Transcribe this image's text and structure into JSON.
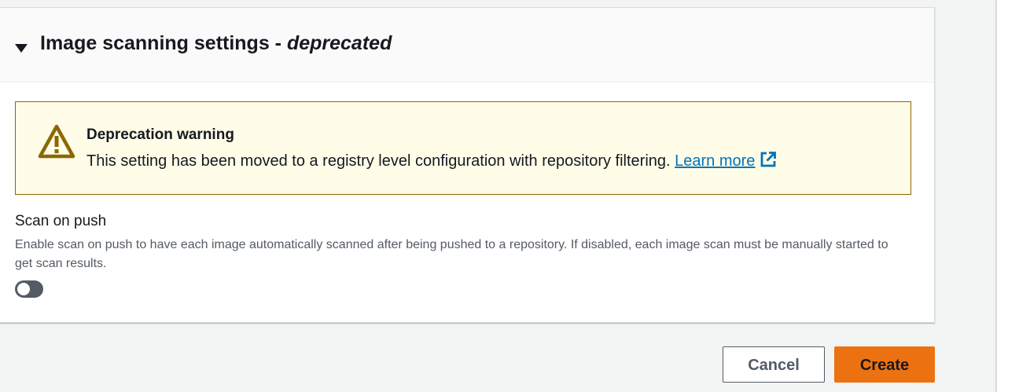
{
  "section": {
    "title_main": "Image scanning settings - ",
    "title_italic": "deprecated"
  },
  "warning": {
    "title": "Deprecation warning",
    "text": "This setting has been moved to a registry level configuration with repository filtering. ",
    "link_label": "Learn more",
    "icon": "warning-triangle-icon",
    "link_icon": "external-link-icon"
  },
  "scan_on_push": {
    "label": "Scan on push",
    "description": "Enable scan on push to have each image automatically scanned after being pushed to a repository. If disabled, each image scan must be manually started to get scan results.",
    "enabled": false
  },
  "actions": {
    "cancel_label": "Cancel",
    "create_label": "Create"
  },
  "colors": {
    "primary_button": "#ec7211",
    "link": "#0073bb",
    "warning_background": "#fffce8",
    "warning_border": "#8d6605",
    "toggle_off": "#545b64"
  }
}
